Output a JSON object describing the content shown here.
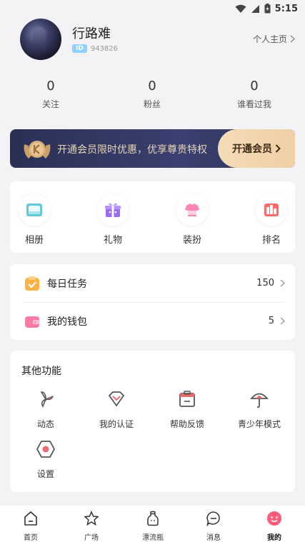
{
  "status_bar": {
    "time": "5:15"
  },
  "profile": {
    "username": "行路难",
    "id_badge": "ID",
    "id_number": "943826",
    "homepage_label": "个人主页"
  },
  "stats": [
    {
      "value": "0",
      "label": "关注"
    },
    {
      "value": "0",
      "label": "粉丝"
    },
    {
      "value": "0",
      "label": "谁看过我"
    }
  ],
  "vip": {
    "promo_text": "开通会员限时优惠，优享尊贵特权",
    "button_label": "开通会员"
  },
  "quick_grid": [
    {
      "label": "相册",
      "icon": "album-icon"
    },
    {
      "label": "礼物",
      "icon": "gift-icon"
    },
    {
      "label": "装扮",
      "icon": "dressup-icon"
    },
    {
      "label": "排名",
      "icon": "ranking-icon"
    }
  ],
  "list_items": [
    {
      "label": "每日任务",
      "value": "150",
      "icon": "daily-task-icon"
    },
    {
      "label": "我的钱包",
      "value": "5",
      "icon": "wallet-icon"
    }
  ],
  "other_functions": {
    "title": "其他功能",
    "items": [
      {
        "label": "动态",
        "icon": "moments-icon"
      },
      {
        "label": "我的认证",
        "icon": "certification-icon"
      },
      {
        "label": "帮助反馈",
        "icon": "help-feedback-icon"
      },
      {
        "label": "青少年模式",
        "icon": "youth-mode-icon"
      },
      {
        "label": "设置",
        "icon": "settings-icon"
      }
    ]
  },
  "tabbar": [
    {
      "label": "首页",
      "icon": "home-icon"
    },
    {
      "label": "广场",
      "icon": "star-icon"
    },
    {
      "label": "漂流瓶",
      "icon": "bottle-icon"
    },
    {
      "label": "消息",
      "icon": "message-icon"
    },
    {
      "label": "我的",
      "icon": "profile-face-icon",
      "active": true
    }
  ],
  "colors": {
    "background": "#f3f3f5",
    "vip_bg": "#2a3054",
    "vip_text": "#e8d3b0",
    "vip_button": "#f4dcb8",
    "active_tab": "#ff5c7c",
    "id_badge": "#8fd0ff"
  }
}
